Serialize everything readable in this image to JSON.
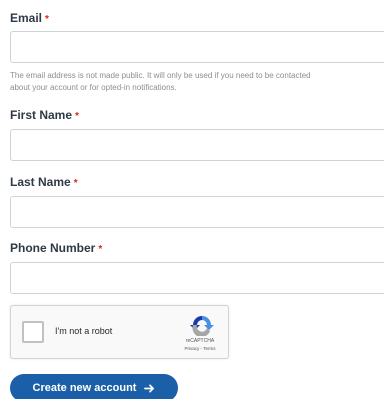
{
  "form": {
    "email": {
      "label": "Email",
      "required_mark": "*",
      "value": "",
      "placeholder": "",
      "help_line_1": "The email address is not made public. It will only be used if you need to be contacted",
      "help_line_2": "about your account or for opted-in notifications."
    },
    "first_name": {
      "label": "First Name",
      "required_mark": "*",
      "value": "",
      "placeholder": ""
    },
    "last_name": {
      "label": "Last Name",
      "required_mark": "*",
      "value": "",
      "placeholder": ""
    },
    "phone": {
      "label": "Phone Number",
      "required_mark": "*",
      "value": "",
      "placeholder": ""
    }
  },
  "captcha": {
    "checkbox_label": "I'm not a robot",
    "brand": "reCAPTCHA",
    "links": "Privacy - Terms",
    "checked": false,
    "icon": "recaptcha-logo-icon"
  },
  "submit": {
    "label": "Create new account",
    "icon": "arrow-right-icon"
  },
  "colors": {
    "label": "#2e3a45",
    "required": "#d6281b",
    "button": "#1a5fa8",
    "help_text": "#8a8f94",
    "input_border": "#cfd3d7"
  }
}
